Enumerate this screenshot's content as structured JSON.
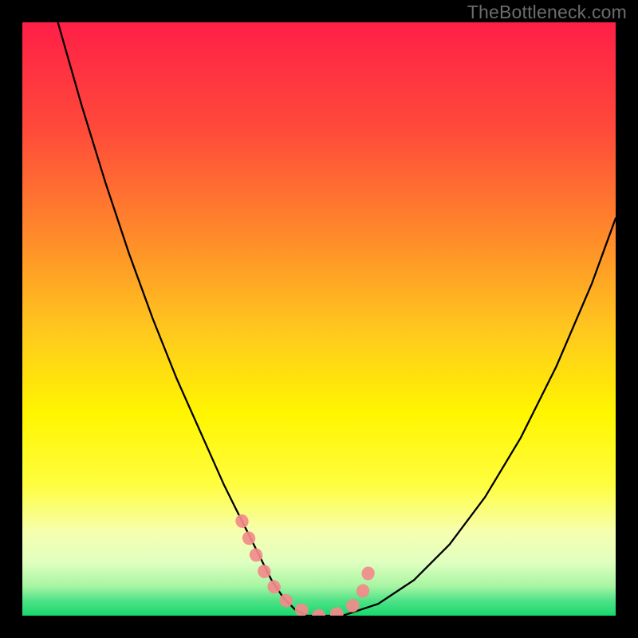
{
  "watermark": "TheBottleneck.com",
  "colors": {
    "pink_stroke": "#f28a8a",
    "curve_stroke": "#000000",
    "green_bottom": "#17d86a",
    "yellow_bright": "#fff600",
    "red_top": "#ff1f47"
  },
  "chart_data": {
    "type": "line",
    "title": "",
    "xlabel": "",
    "ylabel": "",
    "xlim": [
      0,
      100
    ],
    "ylim": [
      0,
      100
    ],
    "series": [
      {
        "name": "bottleneck-curve",
        "x": [
          6,
          10,
          14,
          18,
          22,
          26,
          30,
          34,
          36,
          38,
          40,
          42,
          44,
          46,
          48,
          54,
          60,
          66,
          72,
          78,
          84,
          90,
          96,
          100
        ],
        "y": [
          100,
          86,
          73,
          61,
          50,
          40,
          31,
          22,
          18,
          14,
          10,
          6,
          3,
          1,
          0,
          0,
          2,
          6,
          12,
          20,
          30,
          42,
          56,
          67
        ]
      }
    ],
    "highlight_segment": {
      "name": "trough-marker",
      "x": [
        37,
        39,
        41,
        43,
        45,
        47,
        49,
        52,
        55,
        57,
        58,
        59
      ],
      "y": [
        16,
        11,
        7,
        4,
        2,
        1,
        0,
        0,
        1,
        3,
        6,
        10
      ]
    },
    "gradient_stops": [
      {
        "pos": 0.0,
        "color": "#ff1f47"
      },
      {
        "pos": 0.18,
        "color": "#ff4a3a"
      },
      {
        "pos": 0.36,
        "color": "#ff8a2a"
      },
      {
        "pos": 0.52,
        "color": "#ffc81e"
      },
      {
        "pos": 0.66,
        "color": "#fff600"
      },
      {
        "pos": 0.78,
        "color": "#fffd40"
      },
      {
        "pos": 0.86,
        "color": "#f6ffb0"
      },
      {
        "pos": 0.91,
        "color": "#e0ffc0"
      },
      {
        "pos": 0.95,
        "color": "#a8f5a3"
      },
      {
        "pos": 0.975,
        "color": "#4fe287"
      },
      {
        "pos": 1.0,
        "color": "#17d86a"
      }
    ]
  }
}
